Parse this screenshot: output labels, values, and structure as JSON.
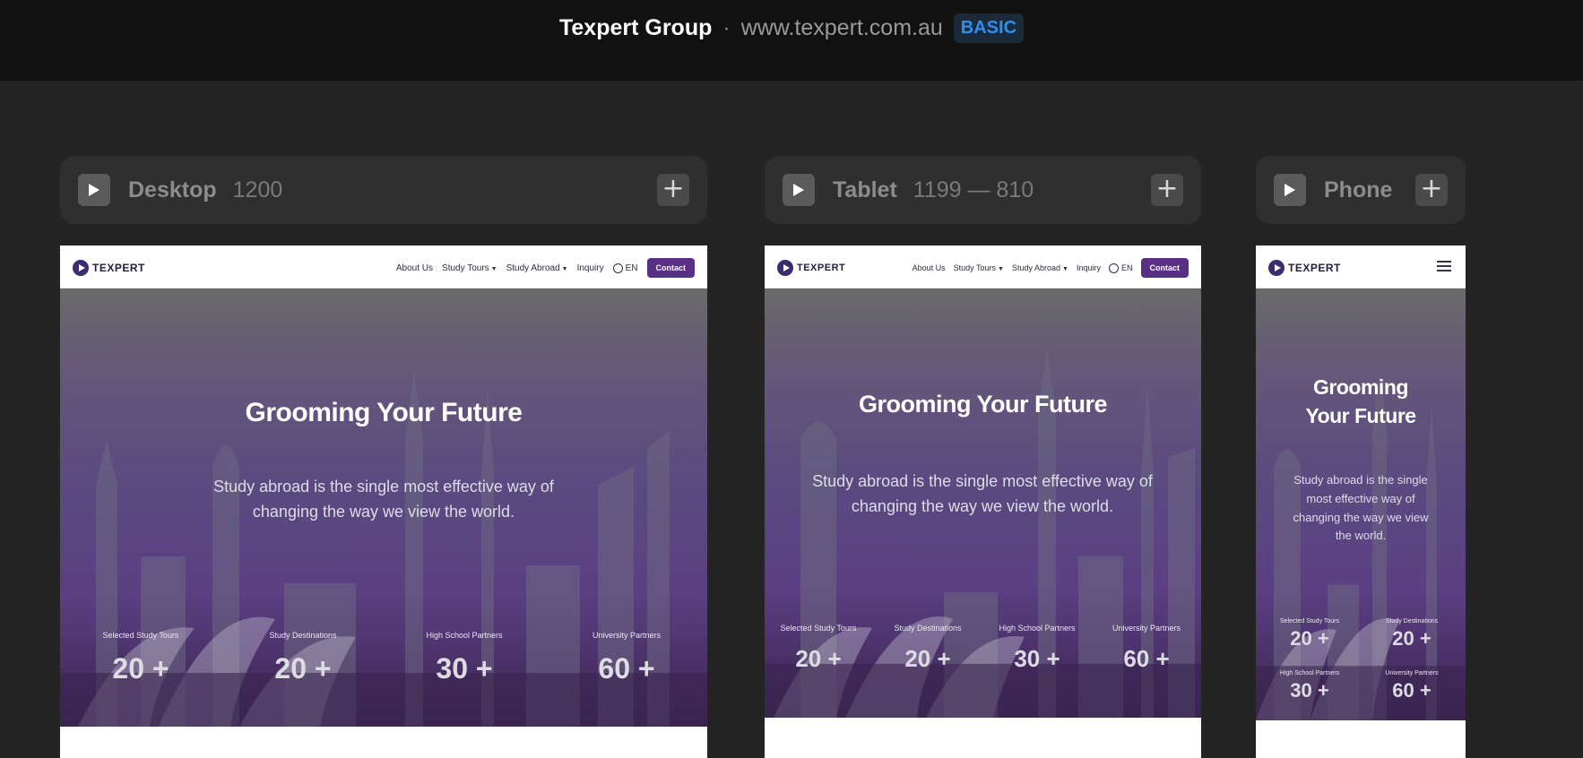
{
  "header": {
    "site_name": "Texpert Group",
    "separator": "·",
    "url": "www.texpert.com.au",
    "badge": "BASIC"
  },
  "viewports": [
    {
      "label": "Desktop",
      "size": "1200"
    },
    {
      "label": "Tablet",
      "size": "1199 — 810"
    },
    {
      "label": "Phone",
      "size": ""
    }
  ],
  "site": {
    "logo_text": "TEXPERT",
    "nav": [
      "About Us",
      "Study Tours",
      "Study Abroad",
      "Inquiry",
      "EN",
      "Contact"
    ],
    "hero_title": "Grooming Your Future",
    "hero_subtitle": "Study abroad is the single most effective way of changing the way we view the world.",
    "stats": [
      {
        "label": "Selected Study Tours",
        "value": "20 +"
      },
      {
        "label": "Study Destinations",
        "value": "20 +"
      },
      {
        "label": "High School Partners",
        "value": "30 +"
      },
      {
        "label": "University Partners",
        "value": "60 +"
      }
    ]
  },
  "colors": {
    "accent_badge": "#2b8ff0",
    "brand_purple": "#5a2f86"
  },
  "icons": [
    "play-icon",
    "plus-icon",
    "globe-icon",
    "menu-icon",
    "caret-down-icon",
    "logo-icon"
  ]
}
